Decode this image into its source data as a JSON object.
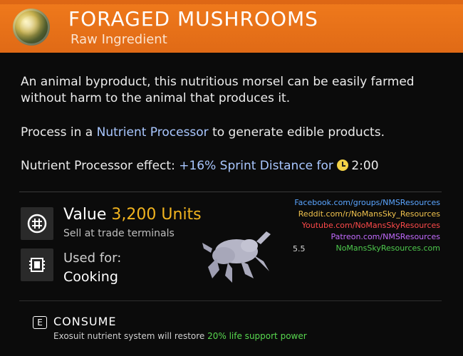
{
  "item": {
    "title": "FORAGED MUSHROOMS",
    "category": "Raw Ingredient",
    "description": "An animal byproduct, this nutritious morsel can be easily farmed without harm to the animal that produces it.",
    "process": {
      "prefix": "Process in a ",
      "link": "Nutrient Processor",
      "suffix": " to generate edible products."
    },
    "effect": {
      "prefix": "Nutrient Processor effect: ",
      "bonus": "+16% Sprint Distance",
      "mid": " for ",
      "time": "2:00"
    }
  },
  "stats": {
    "value_label": "Value ",
    "value_amount": "3,200 Units",
    "value_sub": "Sell at trade terminals",
    "used_label": "Used for:",
    "used_value": "Cooking"
  },
  "links": [
    "Facebook.com/groups/NMSResources",
    "Reddit.com/r/NoMansSky_Resources",
    "Youtube.com/NoMansSkyResources",
    "Patreon.com/NMSResources",
    "NoMansSkyResources.com"
  ],
  "version": "5.5",
  "action": {
    "key": "E",
    "label": "CONSUME",
    "sub_prefix": "Exosuit nutrient system will restore ",
    "sub_highlight": "20% life support power"
  },
  "colors": {
    "header": "#e06a16",
    "gold": "#f2b41f",
    "link_blue": "#a9c7ff",
    "green": "#58d84f"
  },
  "icons": {
    "item": "mushroom-orb-icon",
    "value": "units-currency-icon",
    "used_for": "cooking-chip-icon",
    "timer": "clock-icon"
  }
}
